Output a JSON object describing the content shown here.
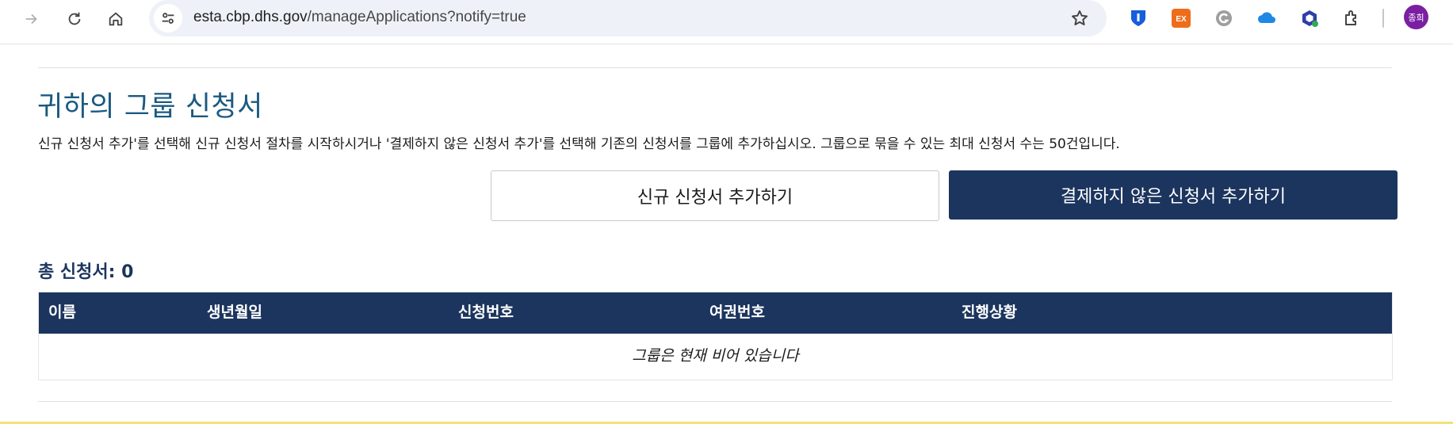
{
  "browser": {
    "url_host": "esta.cbp.dhs.gov",
    "url_path": "/manageApplications?notify=true",
    "profile_initials": "종희",
    "extensions": [
      "bitwarden-icon",
      "ex-extension-icon",
      "grammarly-icon",
      "onedrive-icon",
      "wappalyzer-icon",
      "extensions-puzzle-icon"
    ]
  },
  "page": {
    "title": "귀하의 그룹 신청서",
    "description": "신규 신청서 추가'를 선택해 신규 신청서 절차를 시작하시거나 '결제하지 않은 신청서 추가'를 선택해 기존의 신청서를 그룹에 추가하십시오. 그룹으로 묶을 수 있는 최대 신청서 수는 50건입니다.",
    "add_new_label": "신규 신청서 추가하기",
    "add_unpaid_label": "결제하지 않은 신청서 추가하기",
    "total_label": "총 신청서: 0"
  },
  "table": {
    "columns": [
      "이름",
      "생년월일",
      "신청번호",
      "여권번호",
      "진행상황"
    ],
    "empty_message": "그룹은 현재 비어 있습니다"
  },
  "colors": {
    "primary": "#1c355e",
    "heading": "#1a5a80",
    "avatar": "#7b1fa2"
  }
}
